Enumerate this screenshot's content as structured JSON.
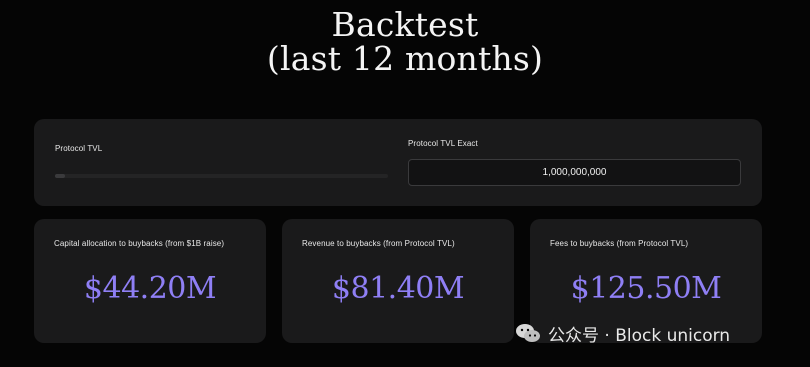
{
  "page": {
    "title_line1": "Backtest",
    "title_line2": "(last 12 months)"
  },
  "controls": {
    "slider_label": "Protocol TVL",
    "slider_value": 0.03,
    "exact_label": "Protocol TVL Exact",
    "exact_value": "1,000,000,000"
  },
  "metrics": [
    {
      "label": "Capital allocation to buybacks (from $1B raise)",
      "value": "$44.20M"
    },
    {
      "label": "Revenue to buybacks (from Protocol TVL)",
      "value": "$81.40M"
    },
    {
      "label": "Fees to buybacks (from Protocol TVL)",
      "value": "$125.50M"
    }
  ],
  "watermark": {
    "text": "公众号 · Block unicorn",
    "icon": "wechat-icon"
  },
  "colors": {
    "background": "#050505",
    "card": "#1a1a1b",
    "accent": "#8f7ff5",
    "text": "#f2f2f2"
  }
}
